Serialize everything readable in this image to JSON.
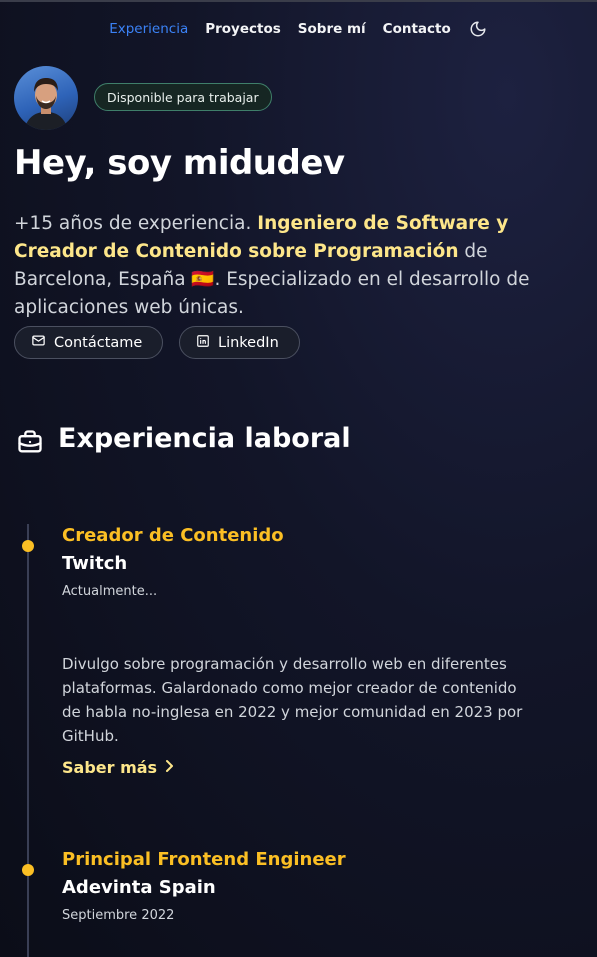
{
  "nav": {
    "items": [
      {
        "label": "Experiencia",
        "active": true
      },
      {
        "label": "Proyectos",
        "active": false
      },
      {
        "label": "Sobre mí",
        "active": false
      },
      {
        "label": "Contacto",
        "active": false
      }
    ],
    "theme_icon": "moon-icon"
  },
  "hero": {
    "badge": "Disponible para trabajar",
    "title": "Hey, soy midudev",
    "intro_prefix": "+15 años de experiencia.",
    "intro_highlight": "Ingeniero de Software y Creador de Contenido sobre Programación",
    "intro_suffix": "de Barcelona, España 🇪🇸. Especializado en el desarrollo de aplicaciones web únicas.",
    "buttons": {
      "contact": "Contáctame",
      "linkedin": "LinkedIn"
    }
  },
  "experience": {
    "title": "Experiencia laboral",
    "items": [
      {
        "role": "Creador de Contenido",
        "company": "Twitch",
        "date": "Actualmente...",
        "description": "Divulgo sobre programación y desarrollo web en diferentes plataformas. Galardonado como mejor creador de contenido de habla no-inglesa en 2022 y mejor comunidad en 2023 por GitHub.",
        "link": "Saber más"
      },
      {
        "role": "Principal Frontend Engineer",
        "company": "Adevinta Spain",
        "date": "Septiembre 2022"
      }
    ]
  },
  "colors": {
    "accent_yellow": "#fbbf24",
    "highlight": "#fde68a",
    "nav_active": "#3b82f6",
    "badge_border": "#3f7f6a"
  }
}
